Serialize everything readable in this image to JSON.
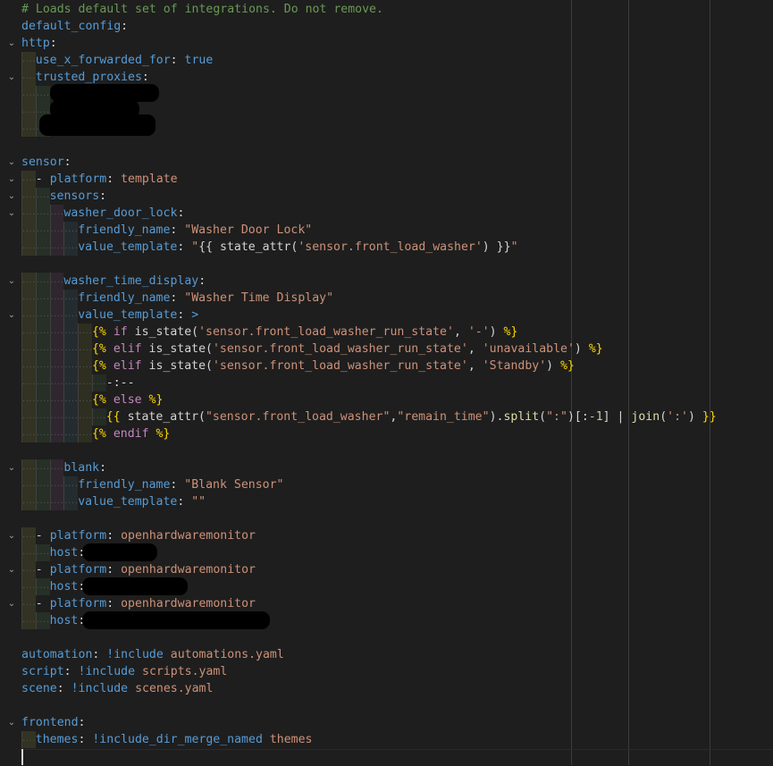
{
  "editor": {
    "lines": [
      {
        "indent": 0,
        "fold": "",
        "tokens": [
          {
            "c": "c",
            "t": "# Loads default set of integrations. Do not remove."
          }
        ]
      },
      {
        "indent": 0,
        "fold": "",
        "tokens": [
          {
            "c": "k",
            "t": "default_config"
          },
          {
            "c": "t",
            "t": ":"
          }
        ]
      },
      {
        "indent": 0,
        "fold": "chevron-down-icon",
        "tokens": [
          {
            "c": "k",
            "t": "http"
          },
          {
            "c": "t",
            "t": ":"
          }
        ]
      },
      {
        "indent": 1,
        "fold": "",
        "tokens": [
          {
            "c": "k",
            "t": "use_x_forwarded_for"
          },
          {
            "c": "t",
            "t": ": "
          },
          {
            "c": "k",
            "t": "true"
          }
        ]
      },
      {
        "indent": 1,
        "fold": "chevron-down-icon",
        "tokens": [
          {
            "c": "k",
            "t": "trusted_proxies"
          },
          {
            "c": "t",
            "t": ":"
          }
        ]
      },
      {
        "indent": 2,
        "fold": "",
        "tokens": []
      },
      {
        "indent": 2,
        "fold": "",
        "tokens": []
      },
      {
        "indent": 2,
        "fold": "",
        "tokens": []
      },
      {
        "indent": 0,
        "fold": "",
        "tokens": []
      },
      {
        "indent": 0,
        "fold": "chevron-down-icon",
        "tokens": [
          {
            "c": "k",
            "t": "sensor"
          },
          {
            "c": "t",
            "t": ":"
          }
        ]
      },
      {
        "indent": 1,
        "fold": "chevron-down-icon",
        "tokens": [
          {
            "c": "t",
            "t": "- "
          },
          {
            "c": "k",
            "t": "platform"
          },
          {
            "c": "t",
            "t": ": "
          },
          {
            "c": "s",
            "t": "template"
          }
        ]
      },
      {
        "indent": 2,
        "fold": "chevron-down-icon",
        "tokens": [
          {
            "c": "k",
            "t": "sensors"
          },
          {
            "c": "t",
            "t": ":"
          }
        ]
      },
      {
        "indent": 3,
        "fold": "chevron-down-icon",
        "tokens": [
          {
            "c": "k",
            "t": "washer_door_lock"
          },
          {
            "c": "t",
            "t": ":"
          }
        ]
      },
      {
        "indent": 4,
        "fold": "",
        "tokens": [
          {
            "c": "k",
            "t": "friendly_name"
          },
          {
            "c": "t",
            "t": ": "
          },
          {
            "c": "s",
            "t": "\"Washer Door Lock\""
          }
        ]
      },
      {
        "indent": 4,
        "fold": "",
        "tokens": [
          {
            "c": "k",
            "t": "value_template"
          },
          {
            "c": "t",
            "t": ": "
          },
          {
            "c": "s",
            "t": "\""
          },
          {
            "c": "t",
            "t": "{{ "
          },
          {
            "c": "t",
            "t": "state_attr("
          },
          {
            "c": "s",
            "t": "'sensor.front_load_washer'"
          },
          {
            "c": "t",
            "t": ") }}"
          },
          {
            "c": "s",
            "t": "\""
          }
        ]
      },
      {
        "indent": 0,
        "fold": "",
        "tokens": []
      },
      {
        "indent": 3,
        "fold": "chevron-down-icon",
        "tokens": [
          {
            "c": "k",
            "t": "washer_time_display"
          },
          {
            "c": "t",
            "t": ":"
          }
        ]
      },
      {
        "indent": 4,
        "fold": "",
        "tokens": [
          {
            "c": "k",
            "t": "friendly_name"
          },
          {
            "c": "t",
            "t": ": "
          },
          {
            "c": "s",
            "t": "\"Washer Time Display\""
          }
        ]
      },
      {
        "indent": 4,
        "fold": "chevron-down-icon",
        "tokens": [
          {
            "c": "k",
            "t": "value_template"
          },
          {
            "c": "t",
            "t": ": "
          },
          {
            "c": "k",
            "t": ">"
          }
        ]
      },
      {
        "indent": 5,
        "fold": "",
        "tokens": [
          {
            "c": "p",
            "t": "{%"
          },
          {
            "c": "kw",
            "t": " if "
          },
          {
            "c": "t",
            "t": "is_state("
          },
          {
            "c": "s",
            "t": "'sensor.front_load_washer_run_state'"
          },
          {
            "c": "t",
            "t": ", "
          },
          {
            "c": "s",
            "t": "'-'"
          },
          {
            "c": "t",
            "t": ") "
          },
          {
            "c": "p",
            "t": "%}"
          }
        ]
      },
      {
        "indent": 5,
        "fold": "",
        "tokens": [
          {
            "c": "p",
            "t": "{%"
          },
          {
            "c": "kw",
            "t": " elif "
          },
          {
            "c": "t",
            "t": "is_state("
          },
          {
            "c": "s",
            "t": "'sensor.front_load_washer_run_state'"
          },
          {
            "c": "t",
            "t": ", "
          },
          {
            "c": "s",
            "t": "'unavailable'"
          },
          {
            "c": "t",
            "t": ") "
          },
          {
            "c": "p",
            "t": "%}"
          }
        ]
      },
      {
        "indent": 5,
        "fold": "",
        "tokens": [
          {
            "c": "p",
            "t": "{%"
          },
          {
            "c": "kw",
            "t": " elif "
          },
          {
            "c": "t",
            "t": "is_state("
          },
          {
            "c": "s",
            "t": "'sensor.front_load_washer_run_state'"
          },
          {
            "c": "t",
            "t": ", "
          },
          {
            "c": "s",
            "t": "'Standby'"
          },
          {
            "c": "t",
            "t": ") "
          },
          {
            "c": "p",
            "t": "%}"
          }
        ]
      },
      {
        "indent": 6,
        "fold": "",
        "tokens": [
          {
            "c": "t",
            "t": "-:--"
          }
        ]
      },
      {
        "indent": 5,
        "fold": "",
        "tokens": [
          {
            "c": "p",
            "t": "{%"
          },
          {
            "c": "kw",
            "t": " else "
          },
          {
            "c": "p",
            "t": "%}"
          }
        ]
      },
      {
        "indent": 6,
        "fold": "",
        "tokens": [
          {
            "c": "p",
            "t": "{{"
          },
          {
            "c": "t",
            "t": " state_attr("
          },
          {
            "c": "s",
            "t": "\"sensor.front_load_washer\""
          },
          {
            "c": "t",
            "t": ","
          },
          {
            "c": "s",
            "t": "\"remain_time\""
          },
          {
            "c": "t",
            "t": ")."
          },
          {
            "c": "f",
            "t": "split"
          },
          {
            "c": "t",
            "t": "("
          },
          {
            "c": "s",
            "t": "\":\""
          },
          {
            "c": "t",
            "t": ")[:"
          },
          {
            "c": "n",
            "t": "-1"
          },
          {
            "c": "t",
            "t": "] | "
          },
          {
            "c": "f",
            "t": "join"
          },
          {
            "c": "t",
            "t": "("
          },
          {
            "c": "s",
            "t": "':'"
          },
          {
            "c": "t",
            "t": ") "
          },
          {
            "c": "p",
            "t": "}}"
          }
        ]
      },
      {
        "indent": 5,
        "fold": "",
        "tokens": [
          {
            "c": "p",
            "t": "{%"
          },
          {
            "c": "kw",
            "t": " endif "
          },
          {
            "c": "p",
            "t": "%}"
          }
        ]
      },
      {
        "indent": 0,
        "fold": "",
        "tokens": []
      },
      {
        "indent": 3,
        "fold": "chevron-down-icon",
        "tokens": [
          {
            "c": "k",
            "t": "blank"
          },
          {
            "c": "t",
            "t": ":"
          }
        ]
      },
      {
        "indent": 4,
        "fold": "",
        "tokens": [
          {
            "c": "k",
            "t": "friendly_name"
          },
          {
            "c": "t",
            "t": ": "
          },
          {
            "c": "s",
            "t": "\"Blank Sensor\""
          }
        ]
      },
      {
        "indent": 4,
        "fold": "",
        "tokens": [
          {
            "c": "k",
            "t": "value_template"
          },
          {
            "c": "t",
            "t": ": "
          },
          {
            "c": "s",
            "t": "\"\""
          }
        ]
      },
      {
        "indent": 0,
        "fold": "",
        "tokens": []
      },
      {
        "indent": 1,
        "fold": "chevron-down-icon",
        "tokens": [
          {
            "c": "t",
            "t": "- "
          },
          {
            "c": "k",
            "t": "platform"
          },
          {
            "c": "t",
            "t": ": "
          },
          {
            "c": "s",
            "t": "openhardwaremonitor"
          }
        ]
      },
      {
        "indent": 2,
        "fold": "",
        "tokens": [
          {
            "c": "k",
            "t": "host"
          },
          {
            "c": "t",
            "t": ":"
          }
        ]
      },
      {
        "indent": 1,
        "fold": "chevron-down-icon",
        "tokens": [
          {
            "c": "t",
            "t": "- "
          },
          {
            "c": "k",
            "t": "platform"
          },
          {
            "c": "t",
            "t": ": "
          },
          {
            "c": "s",
            "t": "openhardwaremonitor"
          }
        ]
      },
      {
        "indent": 2,
        "fold": "",
        "tokens": [
          {
            "c": "k",
            "t": "host"
          },
          {
            "c": "t",
            "t": ":"
          }
        ]
      },
      {
        "indent": 1,
        "fold": "chevron-down-icon",
        "tokens": [
          {
            "c": "t",
            "t": "- "
          },
          {
            "c": "k",
            "t": "platform"
          },
          {
            "c": "t",
            "t": ": "
          },
          {
            "c": "s",
            "t": "openhardwaremonitor"
          }
        ]
      },
      {
        "indent": 2,
        "fold": "",
        "tokens": [
          {
            "c": "k",
            "t": "host"
          },
          {
            "c": "t",
            "t": ":"
          }
        ]
      },
      {
        "indent": 0,
        "fold": "",
        "tokens": []
      },
      {
        "indent": 0,
        "fold": "",
        "tokens": [
          {
            "c": "k",
            "t": "automation"
          },
          {
            "c": "t",
            "t": ": "
          },
          {
            "c": "k",
            "t": "!include"
          },
          {
            "c": "s",
            "t": " automations.yaml"
          }
        ]
      },
      {
        "indent": 0,
        "fold": "",
        "tokens": [
          {
            "c": "k",
            "t": "script"
          },
          {
            "c": "t",
            "t": ": "
          },
          {
            "c": "k",
            "t": "!include"
          },
          {
            "c": "s",
            "t": " scripts.yaml"
          }
        ]
      },
      {
        "indent": 0,
        "fold": "",
        "tokens": [
          {
            "c": "k",
            "t": "scene"
          },
          {
            "c": "t",
            "t": ": "
          },
          {
            "c": "k",
            "t": "!include"
          },
          {
            "c": "s",
            "t": " scenes.yaml"
          }
        ]
      },
      {
        "indent": 0,
        "fold": "",
        "tokens": []
      },
      {
        "indent": 0,
        "fold": "chevron-down-icon",
        "tokens": [
          {
            "c": "k",
            "t": "frontend"
          },
          {
            "c": "t",
            "t": ":"
          }
        ]
      },
      {
        "indent": 1,
        "fold": "",
        "tokens": [
          {
            "c": "k",
            "t": "themes"
          },
          {
            "c": "t",
            "t": ": "
          },
          {
            "c": "k",
            "t": "!include_dir_merge_named"
          },
          {
            "c": "s",
            "t": " themes"
          }
        ]
      }
    ]
  }
}
